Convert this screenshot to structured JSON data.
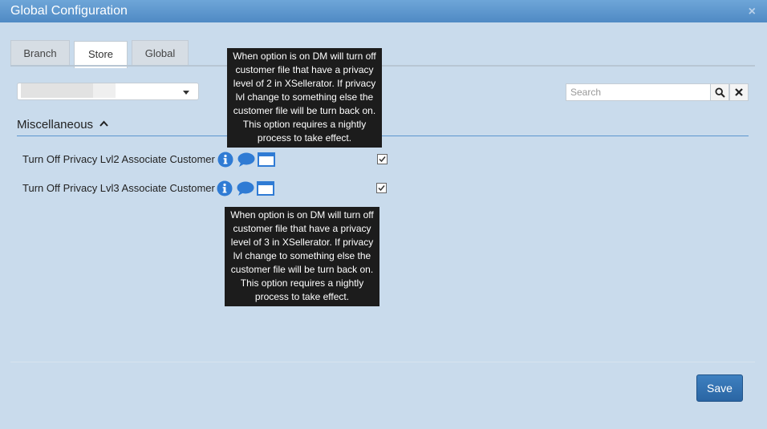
{
  "window": {
    "title": "Global Configuration",
    "close_glyph": "×"
  },
  "tabs": [
    {
      "label": "Branch",
      "active": false
    },
    {
      "label": "Store",
      "active": true
    },
    {
      "label": "Global",
      "active": false
    }
  ],
  "store_select": {
    "value": ""
  },
  "search": {
    "placeholder": "Search",
    "value": "",
    "search_icon": "search-icon",
    "clear_icon": "clear-icon"
  },
  "section": {
    "title": "Miscellaneous",
    "collapse_icon": "chevron-up-icon"
  },
  "settings": [
    {
      "label": "Turn Off Privacy Lvl2 Associate Customer",
      "checked": true,
      "icons": [
        "info-icon",
        "comment-icon",
        "window-icon"
      ]
    },
    {
      "label": "Turn Off Privacy Lvl3 Associate Customer",
      "checked": true,
      "icons": [
        "info-icon",
        "comment-icon",
        "window-icon"
      ]
    }
  ],
  "tooltips": [
    {
      "text": "When option is on DM will turn off customer file that have a privacy level of 2 in XSellerator. If privacy lvl change to something else the customer file will be turn back on. This option requires a nightly process to take effect."
    },
    {
      "text": "When option is on DM will turn off customer file that have a privacy level of 3 in XSellerator. If privacy lvl change to something else the customer file will be turn back on. This option requires a nightly process to take effect."
    }
  ],
  "footer": {
    "save_label": "Save"
  },
  "colors": {
    "titlebar": "#4f8ac4",
    "background": "#c9dbec",
    "accent": "#2f7bd4",
    "tooltip": "#1c1c1c"
  }
}
